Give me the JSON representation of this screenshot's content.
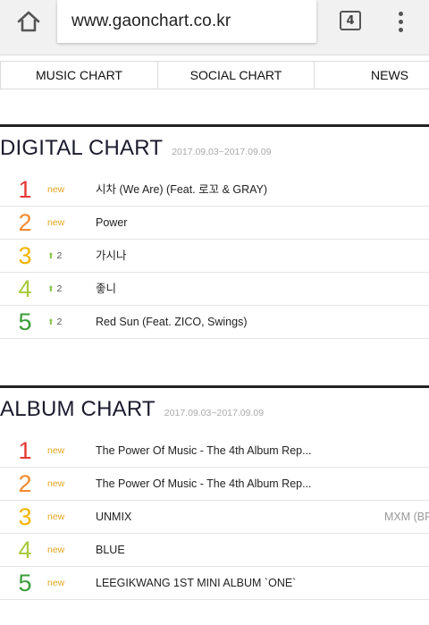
{
  "browser": {
    "url": "www.gaonchart.co.kr",
    "tab_count": "4"
  },
  "nav": {
    "items": [
      {
        "label": "MUSIC CHART"
      },
      {
        "label": "SOCIAL CHART"
      },
      {
        "label": "NEWS"
      }
    ]
  },
  "digital": {
    "title": "DIGITAL CHART",
    "date": "2017.09.03~2017.09.09",
    "rows": [
      {
        "rank": "1",
        "change": "new",
        "title": "시차 (We Are) (Feat. 로꼬 & GRAY)"
      },
      {
        "rank": "2",
        "change": "new",
        "title": "Power"
      },
      {
        "rank": "3",
        "change": "2",
        "title": "가시나"
      },
      {
        "rank": "4",
        "change": "2",
        "title": "좋니"
      },
      {
        "rank": "5",
        "change": "2",
        "title": "Red Sun (Feat. ZICO, Swings)"
      }
    ]
  },
  "album": {
    "title": "ALBUM CHART",
    "date": "2017.09.03~2017.09.09",
    "rows": [
      {
        "rank": "1",
        "change": "new",
        "title": "The Power Of Music - The 4th Album Rep...",
        "artist": ""
      },
      {
        "rank": "2",
        "change": "new",
        "title": "The Power Of Music - The 4th Album Rep...",
        "artist": ""
      },
      {
        "rank": "3",
        "change": "new",
        "title": "UNMIX",
        "artist": "MXM (BR"
      },
      {
        "rank": "4",
        "change": "new",
        "title": "BLUE",
        "artist": ""
      },
      {
        "rank": "5",
        "change": "new",
        "title": "LEEGIKWANG 1ST MINI ALBUM `ONE`",
        "artist": ""
      }
    ]
  },
  "colors": {
    "rank1": "#e53935",
    "rank2": "#f58a2b",
    "rank3": "#f4b400",
    "rank4": "#a8c93a",
    "rank5": "#3a9d3a",
    "new": "#e3a51f",
    "up_arrow": "#8bc34a"
  },
  "icons": {
    "home": "home-icon",
    "tabs": "tab-switcher-icon",
    "menu": "overflow-menu-icon",
    "rank_up": "rank-up-arrow-icon"
  }
}
